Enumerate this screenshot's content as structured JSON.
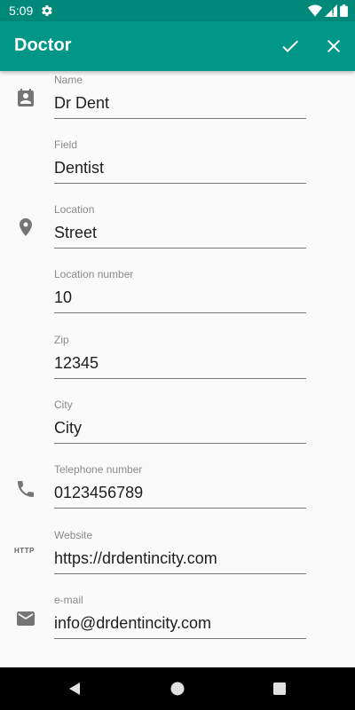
{
  "status_bar": {
    "time": "5:09"
  },
  "app_bar": {
    "title": "Doctor",
    "confirm_icon": "check-icon",
    "close_icon": "close-icon"
  },
  "form": {
    "fields": [
      {
        "label": "Name",
        "value": "Dr Dent",
        "icon": "contact-card-icon"
      },
      {
        "label": "Field",
        "value": "Dentist"
      },
      {
        "label": "Location",
        "value": "Street",
        "icon": "location-pin-icon"
      },
      {
        "label": "Location number",
        "value": "10"
      },
      {
        "label": "Zip",
        "value": "12345"
      },
      {
        "label": "City",
        "value": "City"
      },
      {
        "label": "Telephone number",
        "value": "0123456789",
        "icon": "phone-icon"
      },
      {
        "label": "Website",
        "value": "https://drdentincity.com",
        "icon": "http-icon",
        "icon_text": "HTTP"
      },
      {
        "label": "e-mail",
        "value": "info@drdentincity.com",
        "icon": "email-icon"
      }
    ]
  },
  "colors": {
    "status_bar": "#00897B",
    "app_bar": "#009688",
    "icon_gray": "#757575",
    "background": "#FAFAFA"
  }
}
